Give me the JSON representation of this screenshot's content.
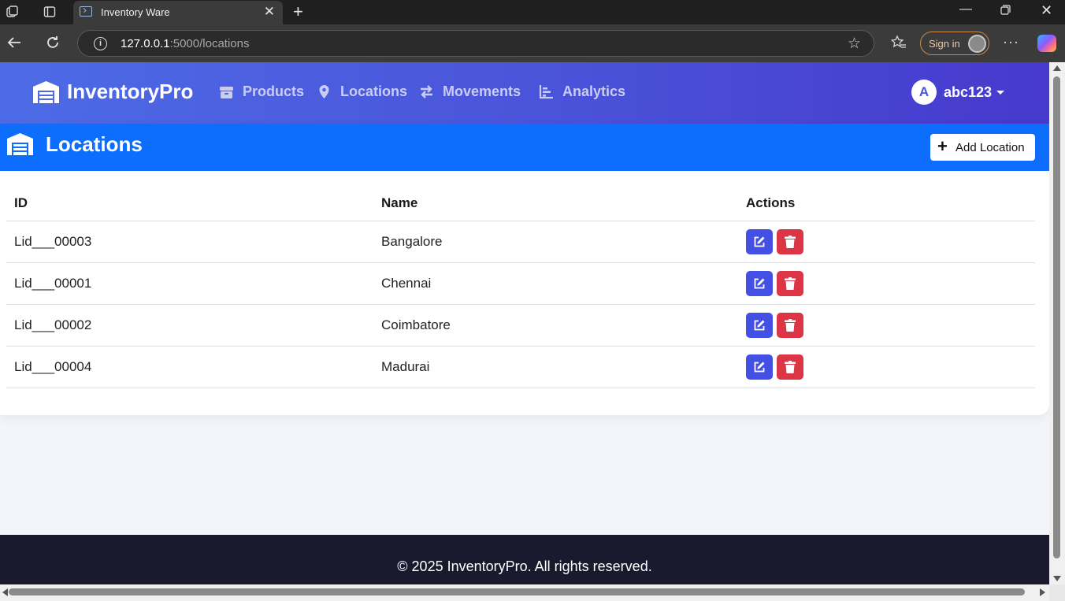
{
  "browser": {
    "tab_title": "Inventory Ware",
    "url_host": "127.0.0.1",
    "url_path": ":5000/locations",
    "sign_in_label": "Sign in"
  },
  "navbar": {
    "brand": "InventoryPro",
    "links": [
      {
        "label": "Products",
        "icon": "box-icon"
      },
      {
        "label": "Locations",
        "icon": "map-pin-icon"
      },
      {
        "label": "Movements",
        "icon": "exchange-arrows-icon"
      },
      {
        "label": "Analytics",
        "icon": "chart-bar-icon"
      }
    ],
    "user_initial": "A",
    "username": "abc123"
  },
  "page": {
    "title": "Locations",
    "add_button_label": "Add Location"
  },
  "table": {
    "headers": [
      "ID",
      "Name",
      "Actions"
    ],
    "rows": [
      {
        "id": "Lid___00003",
        "name": "Bangalore"
      },
      {
        "id": "Lid___00001",
        "name": "Chennai"
      },
      {
        "id": "Lid___00002",
        "name": "Coimbatore"
      },
      {
        "id": "Lid___00004",
        "name": "Madurai"
      }
    ]
  },
  "footer": {
    "text": "© 2025 InventoryPro. All rights reserved."
  },
  "colors": {
    "navbar_start": "#4d6be6",
    "navbar_end": "#4639cc",
    "card_header": "#0d6efd",
    "edit_button": "#4450e4",
    "delete_button": "#dc3545",
    "footer_bg": "#1a1a2e"
  }
}
